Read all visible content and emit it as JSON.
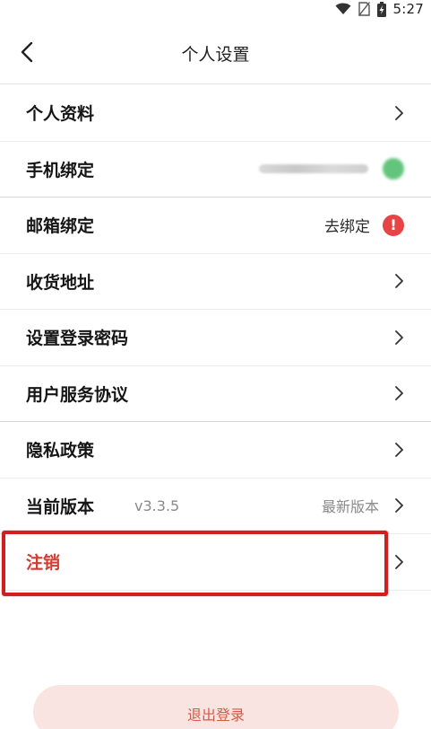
{
  "status_bar": {
    "time": "5:27"
  },
  "header": {
    "title": "个人设置"
  },
  "rows": [
    {
      "label": "个人资料"
    },
    {
      "label": "手机绑定"
    },
    {
      "label": "邮箱绑定",
      "value": "去绑定"
    },
    {
      "label": "收货地址"
    },
    {
      "label": "设置登录密码"
    },
    {
      "label": "用户服务协议"
    },
    {
      "label": "隐私政策"
    },
    {
      "label": "当前版本",
      "version": "v3.3.5",
      "value": "最新版本"
    },
    {
      "label": "注销"
    }
  ],
  "logout": {
    "label": "退出登录"
  },
  "colors": {
    "accent_red": "#d63a2f",
    "alert_red": "#e64545",
    "logout_bg": "#f9e4e1",
    "highlight": "#d11f1f",
    "phone_dot": "#63c57b"
  }
}
